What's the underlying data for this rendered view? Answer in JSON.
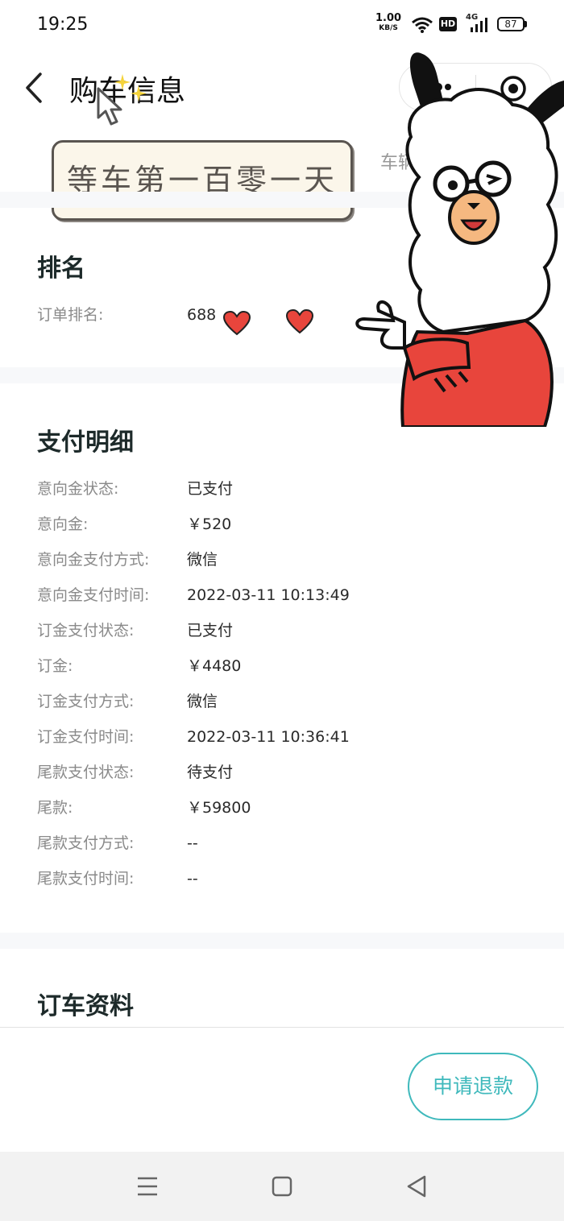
{
  "status_bar": {
    "time": "19:25",
    "net_speed": "1.00",
    "net_unit": "KB/S",
    "hd": "HD",
    "network": "4G",
    "battery": "87"
  },
  "header": {
    "title": "购车信息",
    "back_icon": "chevron-left-icon",
    "capsule_icons": [
      "more-icon",
      "target-icon"
    ]
  },
  "banner": {
    "text": "等车第一百零一天"
  },
  "car_info_label": "车辆",
  "ranking": {
    "title": "排名",
    "rows": [
      {
        "label": "订单排名:",
        "value": "688"
      }
    ]
  },
  "payment": {
    "title": "支付明细",
    "rows": [
      {
        "label": "意向金状态:",
        "value": "已支付"
      },
      {
        "label": "意向金:",
        "value": "￥520"
      },
      {
        "label": "意向金支付方式:",
        "value": "微信"
      },
      {
        "label": "意向金支付时间:",
        "value": "2022-03-11 10:13:49"
      },
      {
        "label": "订金支付状态:",
        "value": "已支付"
      },
      {
        "label": "订金:",
        "value": "￥4480"
      },
      {
        "label": "订金支付方式:",
        "value": "微信"
      },
      {
        "label": "订金支付时间:",
        "value": "2022-03-11 10:36:41"
      },
      {
        "label": "尾款支付状态:",
        "value": "待支付"
      },
      {
        "label": "尾款:",
        "value": "￥59800"
      },
      {
        "label": "尾款支付方式:",
        "value": "--"
      },
      {
        "label": "尾款支付时间:",
        "value": "--"
      }
    ]
  },
  "order_info": {
    "title": "订车资料"
  },
  "actions": {
    "refund": "申请退款"
  },
  "colors": {
    "accent": "#3fb9bc",
    "sticker_red": "#e8453c"
  },
  "nav_icons": [
    "menu-icon",
    "home-icon",
    "back-triangle-icon"
  ]
}
